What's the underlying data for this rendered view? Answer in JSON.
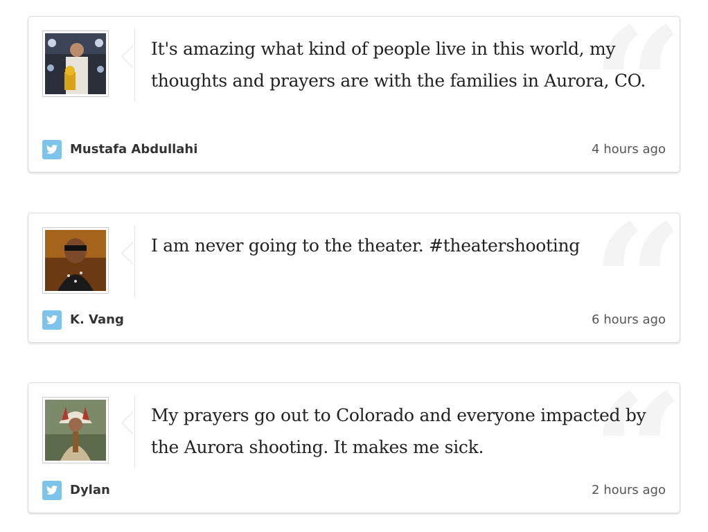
{
  "tweets": [
    {
      "text": "It's amazing what kind of people live in this world, my thoughts and prayers are with the families in Aurora, CO.",
      "author": "Mustafa Abdullahi",
      "time": "4 hours ago"
    },
    {
      "text": "I am never going to the theater. #theatershooting",
      "author": "K. Vang",
      "time": "6 hours ago"
    },
    {
      "text": "My prayers go out to Colorado and everyone impacted by the Aurora shooting. It makes me sick.",
      "author": "Dylan",
      "time": "2 hours ago"
    }
  ],
  "icons": {
    "source": "twitter-icon",
    "quote": "quote-mark-icon"
  },
  "colors": {
    "twitter_blue": "#7ec4ea",
    "text": "#222222",
    "border": "#d8d8d8"
  }
}
